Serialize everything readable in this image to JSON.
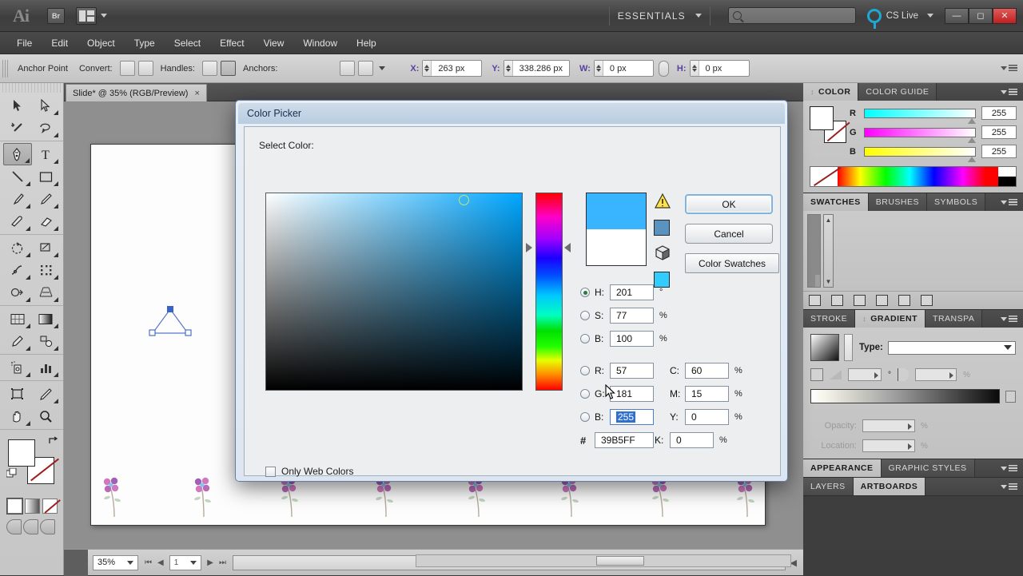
{
  "app": {
    "name": "Adobe Illustrator",
    "logo": "Ai",
    "bridge_label": "Br",
    "workspace": "ESSENTIALS",
    "search_placeholder": "",
    "cs_live": "CS Live"
  },
  "menubar": {
    "items": [
      "File",
      "Edit",
      "Object",
      "Type",
      "Select",
      "Effect",
      "View",
      "Window",
      "Help"
    ]
  },
  "control_bar": {
    "title": "Anchor Point",
    "convert_label": "Convert:",
    "handles_label": "Handles:",
    "anchors_label": "Anchors:",
    "x_label": "X:",
    "x_value": "263 px",
    "y_label": "Y:",
    "y_value": "338.286 px",
    "w_label": "W:",
    "w_value": "0 px",
    "h_label": "H:",
    "h_value": "0 px"
  },
  "toolbar": {
    "tools": [
      "selection-tool",
      "direct-selection-tool",
      "magic-wand-tool",
      "lasso-tool",
      "pen-tool",
      "type-tool",
      "line-segment-tool",
      "rectangle-tool",
      "paintbrush-tool",
      "pencil-tool",
      "blob-brush-tool",
      "eraser-tool",
      "rotate-tool",
      "scale-tool",
      "width-tool",
      "free-transform-tool",
      "shape-builder-tool",
      "perspective-grid-tool",
      "mesh-tool",
      "gradient-tool",
      "eyedropper-tool",
      "blend-tool",
      "symbol-sprayer-tool",
      "column-graph-tool",
      "artboard-tool",
      "slice-tool",
      "hand-tool",
      "zoom-tool"
    ],
    "active_tool": "pen-tool"
  },
  "document": {
    "tab_title": "Slide* @ 35% (RGB/Preview)",
    "close_label": "×"
  },
  "status_bar": {
    "zoom": "35%",
    "page": "1",
    "tool_name": "Pen"
  },
  "color_picker": {
    "title": "Color Picker",
    "select_color_label": "Select Color:",
    "buttons": {
      "ok": "OK",
      "cancel": "Cancel",
      "color_swatches": "Color Swatches"
    },
    "hsb": [
      {
        "key": "H",
        "label": "H:",
        "value": "201",
        "unit": "°",
        "selected": true
      },
      {
        "key": "S",
        "label": "S:",
        "value": "77",
        "unit": "%",
        "selected": false
      },
      {
        "key": "B",
        "label": "B:",
        "value": "100",
        "unit": "%",
        "selected": false
      }
    ],
    "rgb": [
      {
        "key": "R",
        "label": "R:",
        "value": "57",
        "unit": "",
        "selected": false
      },
      {
        "key": "G",
        "label": "G:",
        "value": "181",
        "unit": "",
        "selected": false
      },
      {
        "key": "B",
        "label": "B:",
        "value": "255",
        "unit": "",
        "selected": false,
        "text_selected": true
      }
    ],
    "cmyk": [
      {
        "key": "C",
        "label": "C:",
        "value": "60",
        "unit": "%"
      },
      {
        "key": "M",
        "label": "M:",
        "value": "15",
        "unit": "%"
      },
      {
        "key": "Y",
        "label": "Y:",
        "value": "0",
        "unit": "%"
      },
      {
        "key": "K",
        "label": "K:",
        "value": "0",
        "unit": "%"
      }
    ],
    "hex_label": "#",
    "hex_value": "39B5FF",
    "only_web_colors_label": "Only Web Colors",
    "only_web_colors_checked": false,
    "current_color": "#39B5FF",
    "previous_color": "#FFFFFF",
    "out_of_gamut_icon": "warning-triangle-icon",
    "out_of_gamut_color": "#5a93c0",
    "not_web_safe_icon": "web-cube-icon",
    "web_safe_color": "#33CCFF"
  },
  "panels": {
    "color": {
      "tabs": [
        "COLOR",
        "COLOR GUIDE"
      ],
      "active_tab": "COLOR",
      "channels": [
        {
          "label": "R",
          "value": "255"
        },
        {
          "label": "G",
          "value": "255"
        },
        {
          "label": "B",
          "value": "255"
        }
      ]
    },
    "swatches": {
      "tabs": [
        "SWATCHES",
        "BRUSHES",
        "SYMBOLS"
      ],
      "active_tab": "SWATCHES",
      "colors": [
        "#ffffff",
        "#ffffff",
        "#ffffff",
        "#000000",
        "#ec008c",
        "#ffffff",
        "#00ee76",
        "#2fe07a",
        "#000000",
        "#ec0080",
        "#d71b3b",
        "#e62d4a",
        "#f0562d",
        "#f79646",
        "#f5a463",
        "#fff200",
        "#d7e04a",
        "#8dc63f",
        "#5aba47",
        "#2e9b4e",
        "#0c7a3e",
        "#3bb54a",
        "#00a99d",
        "#29abe2",
        "#1c75bc",
        "#2e3192",
        "#1b1464",
        "#662d91",
        "#92278f",
        "#b5167f",
        "#d6006e",
        "#e6005c",
        "#c8b9a6",
        "#a89684",
        "#8a7260",
        "#6b5343",
        "#c69c6d",
        "#b07f52",
        "#8c5f38",
        "#6f4a28",
        "#5c3a1e",
        "#4a2d16",
        "#7a7a7a",
        "#d8d8d8",
        "#1fb8a0",
        "#ff3c00",
        "#c8dcc8",
        "#cccccc",
        "#cccccc",
        "#cccccc",
        "#cccccc",
        "#cccccc",
        "#cccccc",
        "#cccccc",
        "#cccccc",
        "#cccccc",
        "#aaaaaa",
        "#000000",
        "#1a1a1a",
        "#333333",
        "#3d3d3d",
        "#4d4d4d",
        "#5c5c5c",
        "#6b6b6b",
        "#7a7a7a",
        "#8a8a8a",
        "#999999",
        "#c0c0c0",
        "#e8e8e8",
        "#ffffff",
        "#aaaaaa",
        "#29abe2",
        "#8dc63f",
        "#f7941e",
        "#ed1c24",
        "#f06eaa",
        "#b3c6d9",
        "#cccccc",
        "#cccccc",
        "#cccccc",
        "#cccccc",
        "#cccccc",
        "#cccccc",
        "#cccccc"
      ]
    },
    "gradient": {
      "tabs": [
        "STROKE",
        "GRADIENT",
        "TRANSPA"
      ],
      "active_tab": "GRADIENT",
      "type_label": "Type:",
      "type_value": "",
      "angle_value": "",
      "aspect_value": "",
      "opacity_label": "Opacity:",
      "opacity_value": "",
      "location_label": "Location:",
      "location_value": "",
      "percent": "%"
    },
    "appearance": {
      "tabs": [
        "APPEARANCE",
        "GRAPHIC STYLES"
      ],
      "active_tab": "APPEARANCE"
    },
    "layers": {
      "tabs": [
        "LAYERS",
        "ARTBOARDS"
      ],
      "active_tab": "ARTBOARDS"
    }
  },
  "canvas": {
    "shape": "triangle",
    "shape_stroke": "#4a6fc8",
    "flower_count": 8,
    "flower_colors": [
      "#d07ac0",
      "#a35fb5",
      "#7fc8e8"
    ]
  }
}
